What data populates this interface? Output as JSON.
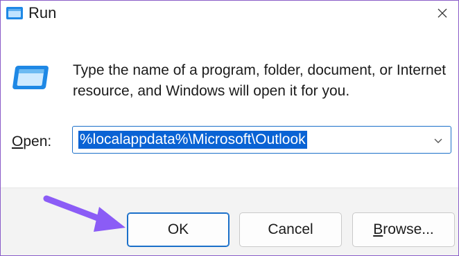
{
  "window": {
    "title": "Run",
    "close_icon": "close-icon"
  },
  "body": {
    "description": "Type the name of a program, folder, document, or Internet resource, and Windows will open it for you.",
    "run_icon": "run-icon"
  },
  "open_field": {
    "label_prefix": "O",
    "label_rest": "pen:",
    "value": "%localappdata%\\Microsoft\\Outlook",
    "dropdown_icon": "chevron-down-icon"
  },
  "buttons": {
    "ok": "OK",
    "cancel": "Cancel",
    "browse_prefix": "B",
    "browse_rest": "rowse..."
  },
  "annotation": {
    "arrow_color": "#8b5cf6"
  },
  "colors": {
    "accent": "#1a6fc9",
    "selection": "#0a63d4",
    "window_border": "#8a5cc8"
  }
}
